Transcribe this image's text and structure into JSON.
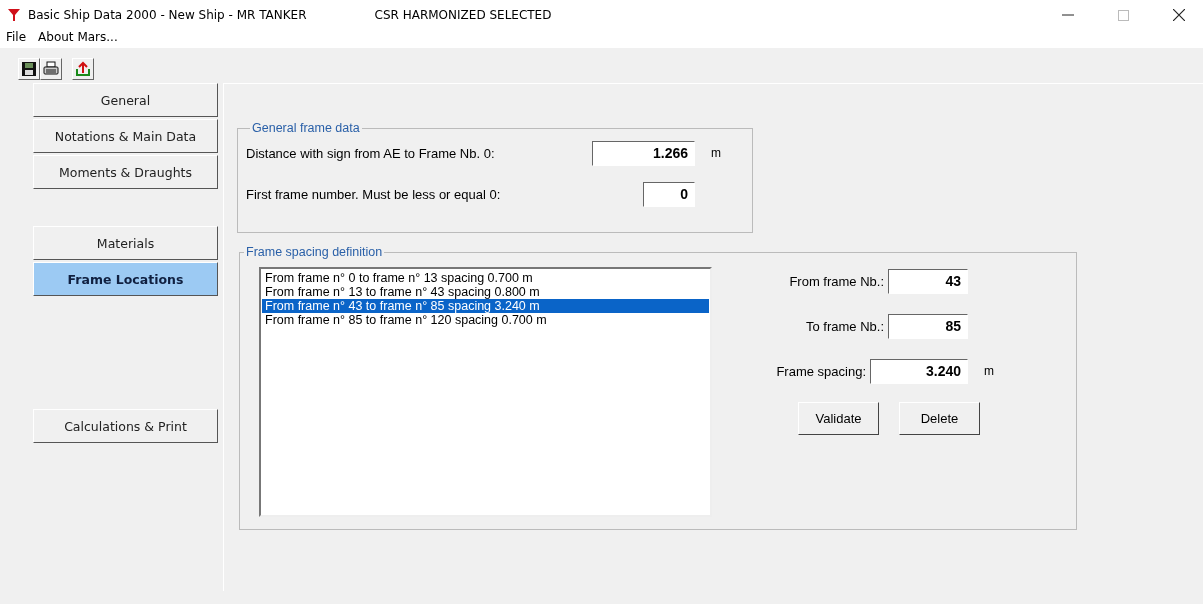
{
  "window": {
    "title": "Basic Ship Data 2000 - New Ship - MR TANKER",
    "subtitle": "CSR HARMONIZED SELECTED"
  },
  "menu": [
    "File",
    "About Mars..."
  ],
  "sidebar": {
    "groups": [
      [
        {
          "label": "General",
          "selected": false
        },
        {
          "label": "Notations & Main Data",
          "selected": false
        },
        {
          "label": "Moments & Draughts",
          "selected": false
        }
      ],
      [
        {
          "label": "Materials",
          "selected": false
        },
        {
          "label": "Frame Locations",
          "selected": true
        }
      ],
      [
        {
          "label": "Calculations & Print",
          "selected": false
        }
      ]
    ]
  },
  "general_frame_data": {
    "title": "General frame data",
    "fields": [
      {
        "label": "Distance with sign from AE to Frame Nb. 0:",
        "value": "1.266",
        "unit": "m"
      },
      {
        "label": "First frame number. Must be less or equal 0:",
        "value": "0"
      }
    ]
  },
  "frame_spacing": {
    "title": "Frame spacing definition",
    "rows": [
      {
        "text": "From frame n° 0 to frame n° 13 spacing 0.700 m",
        "selected": false
      },
      {
        "text": "From frame n° 13 to frame n° 43 spacing 0.800 m",
        "selected": false
      },
      {
        "text": "From frame n° 43 to frame n° 85 spacing 3.240 m",
        "selected": true
      },
      {
        "text": "From frame n° 85 to frame n° 120 spacing 0.700 m",
        "selected": false
      }
    ],
    "fields": [
      {
        "label": "From frame Nb.:",
        "value": "43"
      },
      {
        "label": "To frame Nb.:",
        "value": "85"
      },
      {
        "label": "Frame spacing:",
        "value": "3.240",
        "unit": "m"
      }
    ],
    "buttons": [
      "Validate",
      "Delete"
    ]
  }
}
